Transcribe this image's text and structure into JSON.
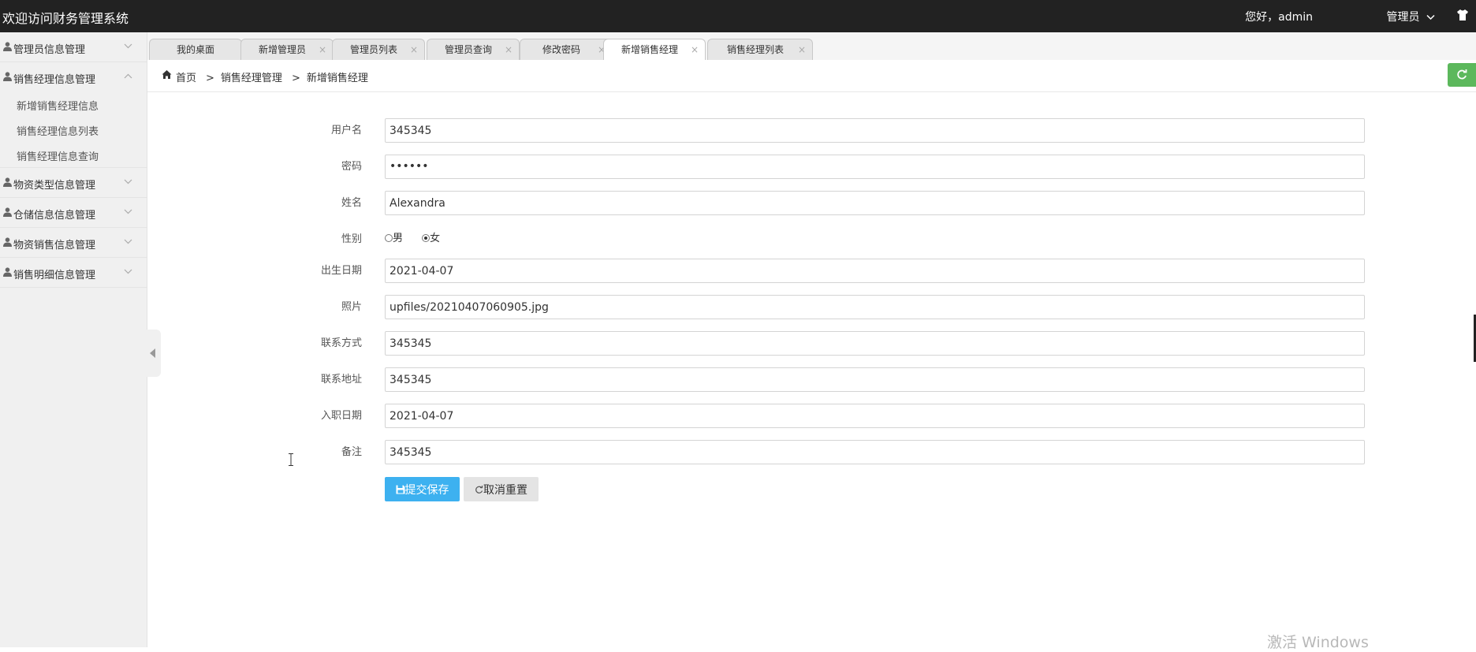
{
  "app": {
    "title": "欢迎访问财务管理系统",
    "greeting": "您好，admin",
    "role": "管理员"
  },
  "sidebar": {
    "groups": [
      {
        "label": "管理员信息管理",
        "expanded": false
      },
      {
        "label": "销售经理信息管理",
        "expanded": true,
        "children": [
          "新增销售经理信息",
          "销售经理信息列表",
          "销售经理信息查询"
        ]
      },
      {
        "label": "物资类型信息管理",
        "expanded": false
      },
      {
        "label": "仓储信息信息管理",
        "expanded": false
      },
      {
        "label": "物资销售信息管理",
        "expanded": false
      },
      {
        "label": "销售明细信息管理",
        "expanded": false
      }
    ]
  },
  "tabs": [
    {
      "label": "我的桌面",
      "closable": false
    },
    {
      "label": "新增管理员",
      "closable": true
    },
    {
      "label": "管理员列表",
      "closable": true
    },
    {
      "label": "管理员查询",
      "closable": true
    },
    {
      "label": "修改密码",
      "closable": true
    },
    {
      "label": "新增销售经理",
      "closable": true,
      "active": true
    },
    {
      "label": "销售经理列表",
      "closable": true
    }
  ],
  "breadcrumb": {
    "home": "首页",
    "items": [
      "销售经理管理",
      "新增销售经理"
    ],
    "separator": ">"
  },
  "form": {
    "username": {
      "label": "用户名",
      "value": "345345"
    },
    "password": {
      "label": "密码",
      "value": "••••••"
    },
    "name": {
      "label": "姓名",
      "value": "Alexandra"
    },
    "gender": {
      "label": "性别",
      "options": [
        "男",
        "女"
      ],
      "selected": "女"
    },
    "birth_date": {
      "label": "出生日期",
      "value": "2021-04-07"
    },
    "photo": {
      "label": "照片",
      "value": "upfiles/20210407060905.jpg"
    },
    "contact": {
      "label": "联系方式",
      "value": "345345"
    },
    "address": {
      "label": "联系地址",
      "value": "345345"
    },
    "hire_date": {
      "label": "入职日期",
      "value": "2021-04-07"
    },
    "remark": {
      "label": "备注",
      "value": "345345"
    }
  },
  "buttons": {
    "submit": "提交保存",
    "reset": "取消重置"
  },
  "watermark": "激活 Windows",
  "colors": {
    "topbar": "#222222",
    "primary": "#3db1f0",
    "success": "#5cb85c",
    "sidebar": "#f0f0f0"
  }
}
